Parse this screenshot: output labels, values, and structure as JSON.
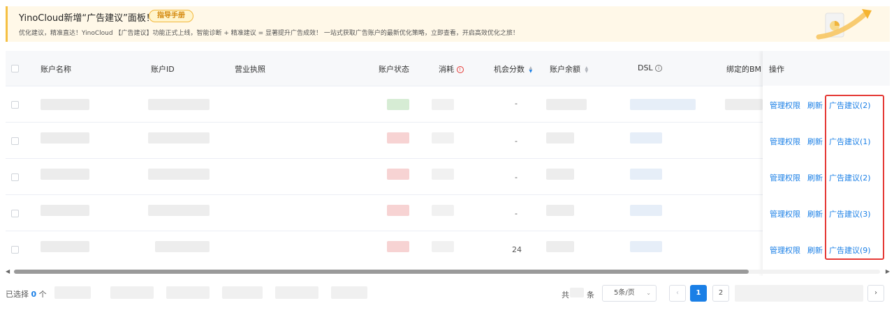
{
  "banner": {
    "title": "YinoCloud新增“广告建议”面板！",
    "guide_button": "指导手册",
    "description": "优化建议，精准直达！YinoCloud 【广告建议】功能正式上线，智能诊断 + 精准建议 = 显著提升广告成效！ 一站式获取广告账户的最新优化策略，立即查看，开启高效优化之旅！"
  },
  "table": {
    "headers": {
      "account_name": "账户名称",
      "account_id": "账户ID",
      "business_license": "营业执照",
      "account_status": "账户状态",
      "spend": "消耗",
      "opportunity_score": "机会分数",
      "balance": "账户余额",
      "dsl": "DSL",
      "bound_bm": "绑定的BM",
      "actions": "操作"
    },
    "rows": [
      {
        "score": "-",
        "status_color": "#cfe9cf",
        "manage": "管理权限",
        "refresh": "刷新",
        "suggest": "广告建议(2)"
      },
      {
        "score": "-",
        "status_color": "#f6c9c9",
        "manage": "管理权限",
        "refresh": "刷新",
        "suggest": "广告建议(1)"
      },
      {
        "score": "-",
        "status_color": "#f6c9c9",
        "manage": "管理权限",
        "refresh": "刷新",
        "suggest": "广告建议(2)"
      },
      {
        "score": "-",
        "status_color": "#f6c9c9",
        "manage": "管理权限",
        "refresh": "刷新",
        "suggest": "广告建议(3)"
      },
      {
        "score": "24",
        "status_color": "#f6c9c9",
        "manage": "管理权限",
        "refresh": "刷新",
        "suggest": "广告建议(9)"
      }
    ]
  },
  "footer": {
    "selected_prefix": "已选择",
    "selected_count": "0",
    "selected_suffix": "个",
    "total_prefix": "共",
    "total_suffix": "条",
    "page_size": "5条/页",
    "pages": [
      "1",
      "2"
    ],
    "current_page": "1"
  },
  "colors": {
    "accent": "#1a7fe6",
    "highlight_border": "#e53935",
    "banner_bg": "#fff8e8",
    "banner_accent": "#f5c043"
  }
}
